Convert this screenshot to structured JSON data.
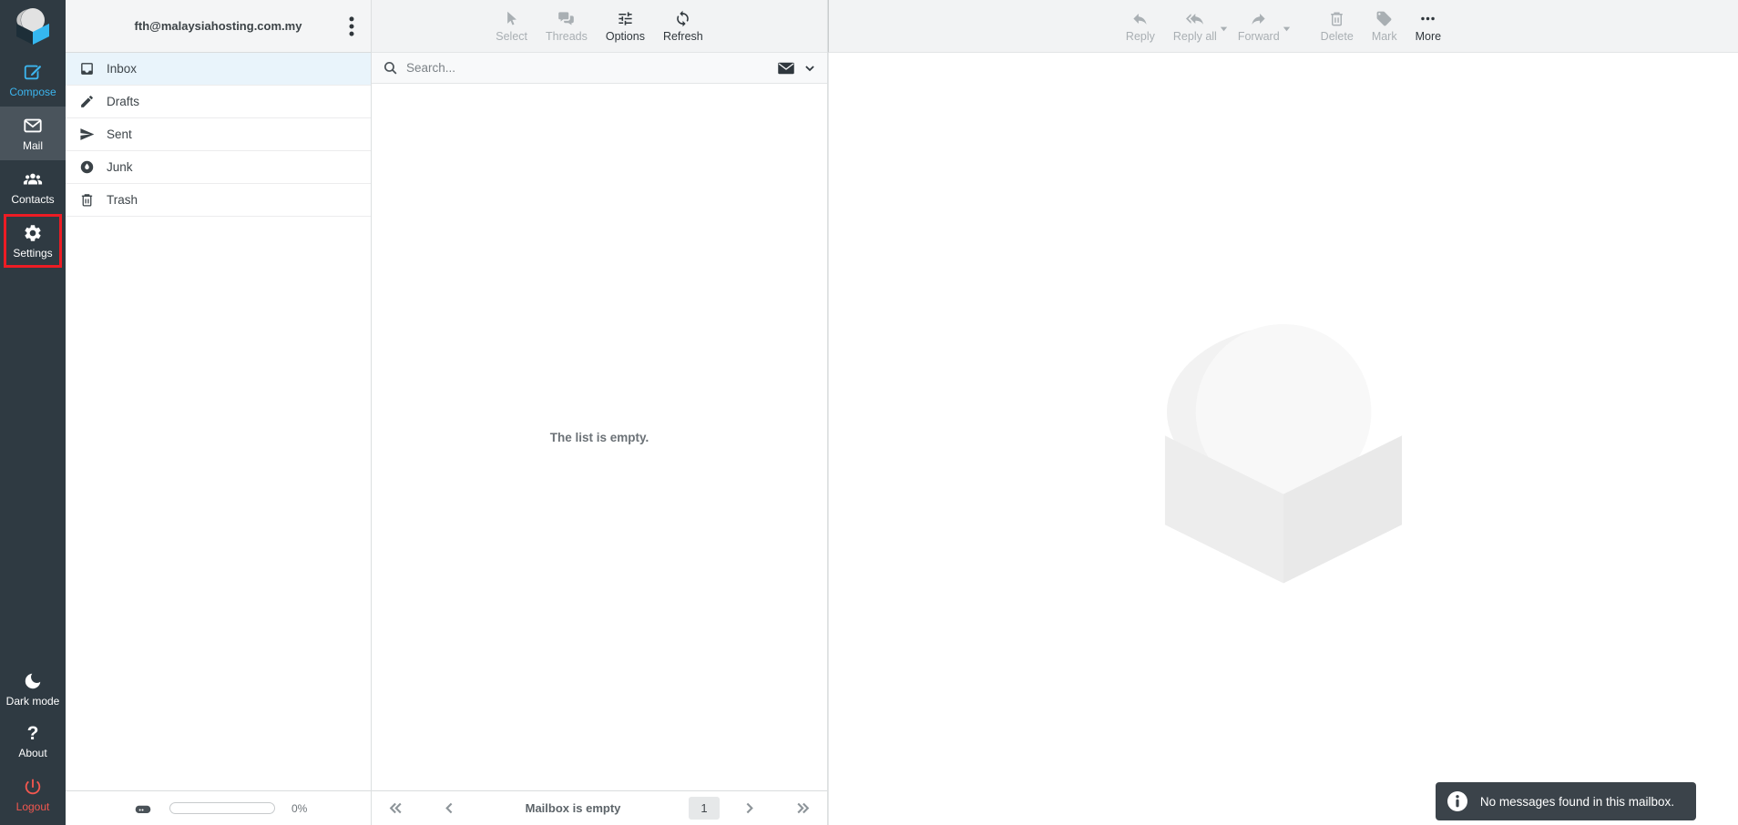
{
  "sidebar": {
    "compose": "Compose",
    "mail": "Mail",
    "contacts": "Contacts",
    "settings": "Settings",
    "dark_mode": "Dark mode",
    "about": "About",
    "about_icon_glyph": "?",
    "logout": "Logout"
  },
  "folders": {
    "account": "fth@malaysiahosting.com.my",
    "items": [
      {
        "label": "Inbox",
        "selected": true
      },
      {
        "label": "Drafts",
        "selected": false
      },
      {
        "label": "Sent",
        "selected": false
      },
      {
        "label": "Junk",
        "selected": false
      },
      {
        "label": "Trash",
        "selected": false
      }
    ],
    "quota": "0%"
  },
  "list_toolbar": {
    "select": "Select",
    "threads": "Threads",
    "options": "Options",
    "refresh": "Refresh"
  },
  "search": {
    "placeholder": "Search..."
  },
  "list": {
    "empty_text": "The list is empty.",
    "footer_status": "Mailbox is empty",
    "page": "1"
  },
  "mail_toolbar": {
    "reply": "Reply",
    "reply_all": "Reply all",
    "forward": "Forward",
    "delete": "Delete",
    "mark": "Mark",
    "more": "More"
  },
  "toast": {
    "text": "No messages found in this mailbox."
  },
  "colors": {
    "accent_blue": "#3cb5ee",
    "sidebar_bg": "#2f3a42",
    "sidebar_selected_bg": "#4a545c",
    "highlight_red": "#ed1c24",
    "logout_red": "#f2574f",
    "selected_folder_bg": "#e9f4fb",
    "toolbar_bg": "#f2f3f4",
    "toast_bg": "#3b434a"
  },
  "icons": {
    "taskmenu": [
      "roundcube-logo",
      "compose-icon",
      "mail-icon",
      "contacts-icon",
      "settings-gear-icon",
      "moon-icon",
      "question-icon",
      "power-icon"
    ],
    "folders": [
      "inbox-icon",
      "pencil-icon",
      "paper-plane-icon",
      "flame-icon",
      "trash-icon"
    ],
    "toolbars": [
      "cursor-icon",
      "threads-icon",
      "sliders-icon",
      "refresh-icon",
      "reply-icon",
      "reply-all-icon",
      "forward-icon",
      "trash-icon",
      "tag-icon",
      "ellipsis-icon"
    ]
  }
}
